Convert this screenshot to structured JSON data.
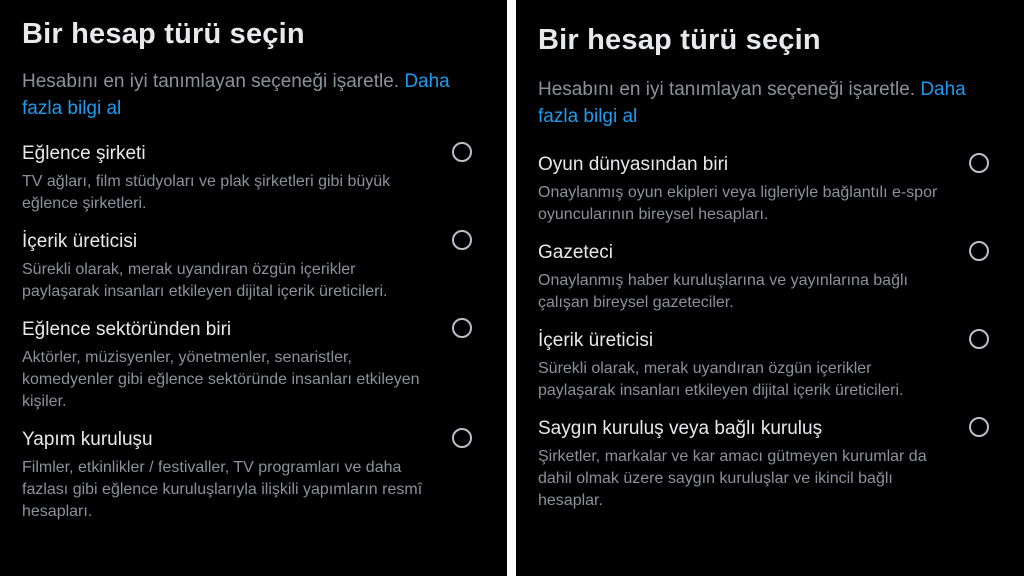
{
  "left": {
    "title": "Bir hesap türü seçin",
    "subtitle": "Hesabını en iyi tanımlayan seçeneği işaretle.",
    "link": "Daha fazla bilgi al",
    "options": [
      {
        "label": "Eğlence şirketi",
        "desc": "TV ağları, film stüdyoları ve plak şirketleri gibi büyük eğlence şirketleri."
      },
      {
        "label": "İçerik üreticisi",
        "desc": "Sürekli olarak, merak uyandıran özgün içerikler paylaşarak insanları etkileyen dijital içerik üreticileri."
      },
      {
        "label": "Eğlence sektöründen biri",
        "desc": "Aktörler, müzisyenler, yönetmenler, senaristler, komedyenler gibi eğlence sektöründe insanları etkileyen kişiler."
      },
      {
        "label": "Yapım kuruluşu",
        "desc": "Filmler, etkinlikler / festivaller, TV programları ve daha fazlası gibi eğlence kuruluşlarıyla ilişkili yapımların resmî hesapları."
      }
    ]
  },
  "right": {
    "title": "Bir hesap türü seçin",
    "subtitle": "Hesabını en iyi tanımlayan seçeneği işaretle.",
    "link": "Daha fazla bilgi al",
    "options": [
      {
        "label": "Oyun dünyasından biri",
        "desc": "Onaylanmış oyun ekipleri veya ligleriyle bağlantılı e-spor oyuncularının bireysel hesapları."
      },
      {
        "label": "Gazeteci",
        "desc": "Onaylanmış haber kuruluşlarına ve yayınlarına bağlı çalışan bireysel gazeteciler."
      },
      {
        "label": "İçerik üreticisi",
        "desc": "Sürekli olarak, merak uyandıran özgün içerikler paylaşarak insanları etkileyen dijital içerik üreticileri."
      },
      {
        "label": "Saygın kuruluş veya bağlı kuruluş",
        "desc": "Şirketler, markalar ve kar amacı gütmeyen kurumlar da dahil olmak üzere saygın kuruluşlar ve ikincil bağlı hesaplar."
      }
    ]
  }
}
